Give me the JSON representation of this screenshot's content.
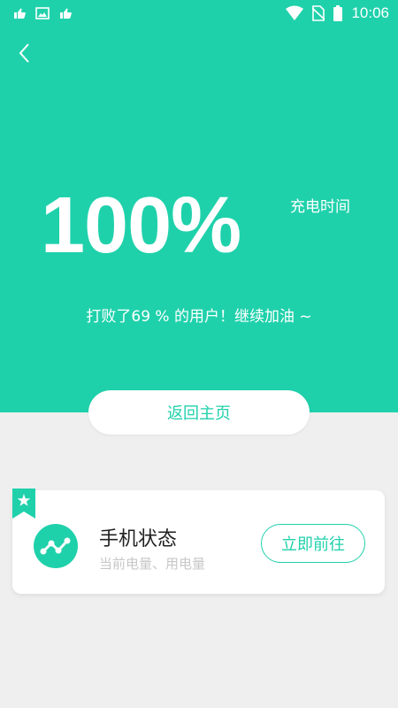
{
  "status_bar": {
    "time": "10:06",
    "left_icons": [
      "app-notification-icon",
      "image-notification-icon",
      "app-notification-icon"
    ],
    "right_icons": [
      "wifi-icon",
      "no-sim-icon",
      "battery-icon"
    ]
  },
  "header": {
    "back_icon": "chevron-left-icon"
  },
  "charge": {
    "percent": "100%",
    "time_label": "充电时间",
    "beat_text": "打败了69 % 的用户！继续加油 ~"
  },
  "home_button": {
    "label": "返回主页"
  },
  "card": {
    "ribbon_icon": "star-icon",
    "icon": "phone-status-icon",
    "title": "手机状态",
    "subtitle": "当前电量、用电量",
    "action_label": "立即前往"
  },
  "colors": {
    "accent": "#1fd1ab",
    "background": "#efefef",
    "card_bg": "#ffffff",
    "title_text": "#222222",
    "subtitle_text": "#c7c7c7"
  }
}
